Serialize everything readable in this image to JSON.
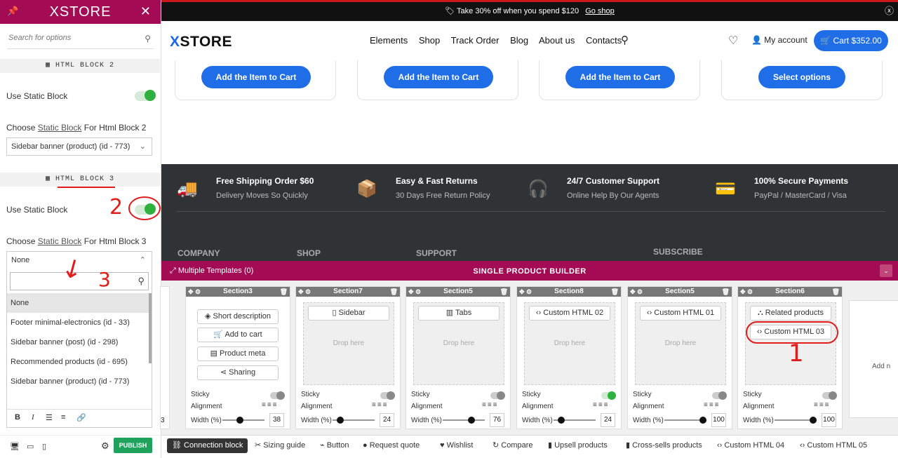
{
  "panel": {
    "logo": "XSTORE",
    "search_placeholder": "Search for options",
    "section1_title": "HTML BLOCK 2",
    "use_static_1": "Use Static Block",
    "choose1_pre": "Choose",
    "choose1_link": "Static Block",
    "choose1_post": "For Html Block 2",
    "select1_value": "Sidebar banner (product) (id - 773)",
    "section2_title": "HTML BLOCK 3",
    "use_static_2": "Use Static Block",
    "choose2_pre": "Choose",
    "choose2_link": "Static Block",
    "choose2_post": "For Html Block 3",
    "select2_value": "None",
    "dropdown_options": [
      "None",
      "Footer minimal-electronics (id - 33)",
      "Sidebar banner (post) (id - 298)",
      "Recommended products (id - 695)",
      "Sidebar banner (product) (id - 773)"
    ],
    "publish": "PUBLISH"
  },
  "annotations": {
    "mark2": "2",
    "mark3": "3",
    "mark1": "1"
  },
  "topbar": {
    "promo": "Take 30% off when you spend $120",
    "link": "Go shop"
  },
  "header": {
    "brand_x": "X",
    "brand_rest": "STORE",
    "nav": [
      "Elements",
      "Shop",
      "Track Order",
      "Blog",
      "About us",
      "Contacts"
    ],
    "account": "My account",
    "cart": "Cart $352.00"
  },
  "cards": [
    "Add the Item to Cart",
    "Add the Item to Cart",
    "Add the Item to Cart",
    "Select options"
  ],
  "features": [
    {
      "title": "Free Shipping Order $60",
      "sub": "Delivery Moves So Quickly"
    },
    {
      "title": "Easy & Fast Returns",
      "sub": "30 Days Free Return Policy"
    },
    {
      "title": "24/7 Customer Support",
      "sub": "Online Help By Our Agents"
    },
    {
      "title": "100% Secure Payments",
      "sub": "PayPal / MasterCard / Visa"
    }
  ],
  "footer_cols": [
    "COMPANY",
    "SHOP",
    "SUPPORT",
    "SUBSCRIBE"
  ],
  "builder": {
    "multiple_templates": "Multiple Templates (0)",
    "title": "SINGLE PRODUCT BUILDER",
    "drop_here": "Drop here",
    "sticky": "Sticky",
    "alignment": "Alignment",
    "width": "Width (%)",
    "sections": [
      {
        "name": "Section3",
        "items": [
          "Short description",
          "Add to cart",
          "Product meta",
          "Sharing"
        ],
        "width": "38",
        "sticky": false
      },
      {
        "name": "Section7",
        "items": [
          "Sidebar"
        ],
        "width": "24",
        "sticky": false
      },
      {
        "name": "Section5",
        "items": [
          "Tabs"
        ],
        "width": "76",
        "sticky": false
      },
      {
        "name": "Section8",
        "items": [
          "Custom HTML 02"
        ],
        "width": "24",
        "sticky": true
      },
      {
        "name": "Section5",
        "items": [
          "Custom HTML 01"
        ],
        "width": "100",
        "sticky": false
      },
      {
        "name": "Section6",
        "items": [
          "Related products",
          "Custom HTML 03"
        ],
        "width": "100",
        "sticky": false
      }
    ],
    "partial_width": "3",
    "right_partial": "Add n"
  },
  "connections": [
    "Connection block",
    "Sizing guide",
    "Button",
    "Request quote",
    "Wishlist",
    "Compare",
    "Upsell products",
    "Cross-sells products",
    "Custom HTML 04",
    "Custom HTML 05"
  ]
}
